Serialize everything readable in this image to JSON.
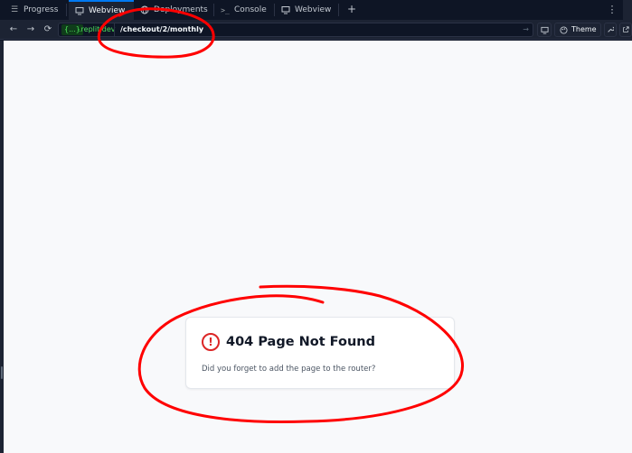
{
  "tabs": [
    {
      "label": "Progress",
      "icon": "progress-icon",
      "active": false
    },
    {
      "label": "Webview",
      "icon": "monitor-icon",
      "active": true
    },
    {
      "label": "Deployments",
      "icon": "globe-icon",
      "active": false
    },
    {
      "label": "Console",
      "icon": "terminal-icon",
      "active": false
    },
    {
      "label": "Webview",
      "icon": "monitor-icon",
      "active": false
    }
  ],
  "tabbar": {
    "new_tab": "+",
    "menu": "⋮"
  },
  "addressbar": {
    "back": "←",
    "forward": "→",
    "reload": "⟳",
    "domain_badge": "{...}",
    "domain_suffix": ".replit.dev",
    "path": "/checkout/2/monthly",
    "go": "→",
    "theme_label": "Theme"
  },
  "page": {
    "error_title": "404 Page Not Found",
    "error_message": "Did you forget to add the page to the router?",
    "error_icon": "!"
  },
  "colors": {
    "accent": "#0079f2",
    "domain_green": "#4ee35a",
    "error_red": "#dc2626",
    "annotation_red": "#ff0000"
  }
}
